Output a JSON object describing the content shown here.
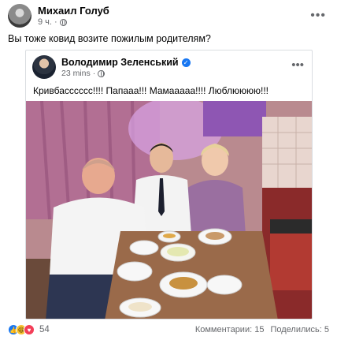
{
  "post": {
    "author": "Михаил Голуб",
    "time": "9 ч.",
    "text": "Вы тоже ковид возите пожилым родителям?",
    "more_icon": "more-horizontal-icon",
    "privacy_icon": "globe-icon"
  },
  "shared": {
    "author": "Володимир Зеленський",
    "time": "23 mins",
    "text": "Кривбасссссс!!!! Папааа!!! Мамааааа!!!! Люблюююю!!!",
    "verified_icon": "verified-badge-icon",
    "privacy_icon": "globe-icon"
  },
  "footer": {
    "reactions": [
      "like",
      "haha",
      "love"
    ],
    "reaction_count": "54",
    "comments": "Комментарии: 15",
    "shares": "Поделились: 5"
  },
  "colors": {
    "brand_blue": "#1877f2",
    "secondary_text": "#65676b",
    "border": "#dadde1"
  }
}
